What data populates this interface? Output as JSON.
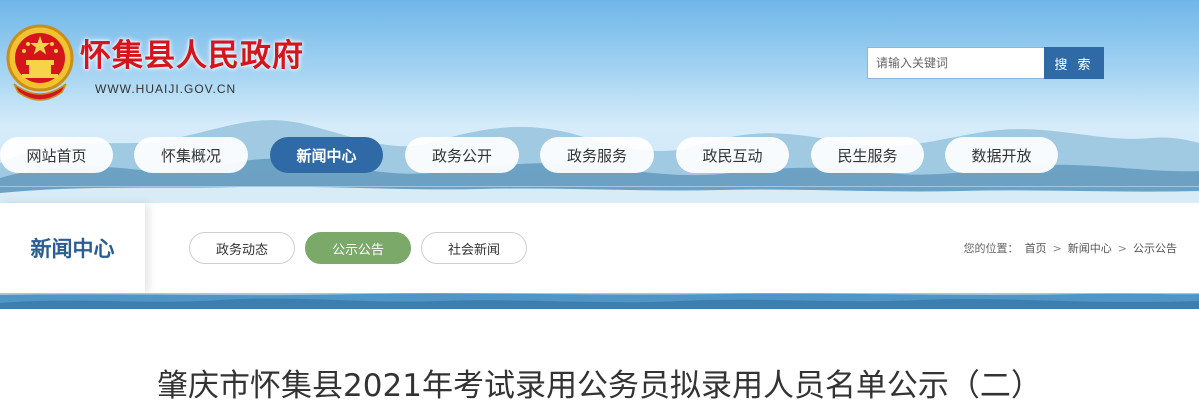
{
  "header": {
    "site_title": "怀集县人民政府",
    "site_url": "WWW.HUAIJI.GOV.CN",
    "search": {
      "placeholder": "请输入关键词",
      "button_label": "搜 索"
    }
  },
  "nav": {
    "items": [
      {
        "label": "网站首页",
        "active": false
      },
      {
        "label": "怀集概况",
        "active": false
      },
      {
        "label": "新闻中心",
        "active": true
      },
      {
        "label": "政务公开",
        "active": false
      },
      {
        "label": "政务服务",
        "active": false
      },
      {
        "label": "政民互动",
        "active": false
      },
      {
        "label": "民生服务",
        "active": false
      },
      {
        "label": "数据开放",
        "active": false
      }
    ]
  },
  "section": {
    "title": "新闻中心",
    "tabs": [
      {
        "label": "政务动态",
        "active": false
      },
      {
        "label": "公示公告",
        "active": true
      },
      {
        "label": "社会新闻",
        "active": false
      }
    ],
    "breadcrumb": {
      "prefix": "您的位置：",
      "items": [
        "首页",
        "新闻中心",
        "公示公告"
      ],
      "separator": ">"
    }
  },
  "article": {
    "title": "肇庆市怀集县2021年考试录用公务员拟录用人员名单公示（二）"
  },
  "colors": {
    "brand_red": "#d4151b",
    "nav_active": "#2f6aa6",
    "tab_active": "#7aa96a",
    "section_title": "#2a5d91"
  }
}
